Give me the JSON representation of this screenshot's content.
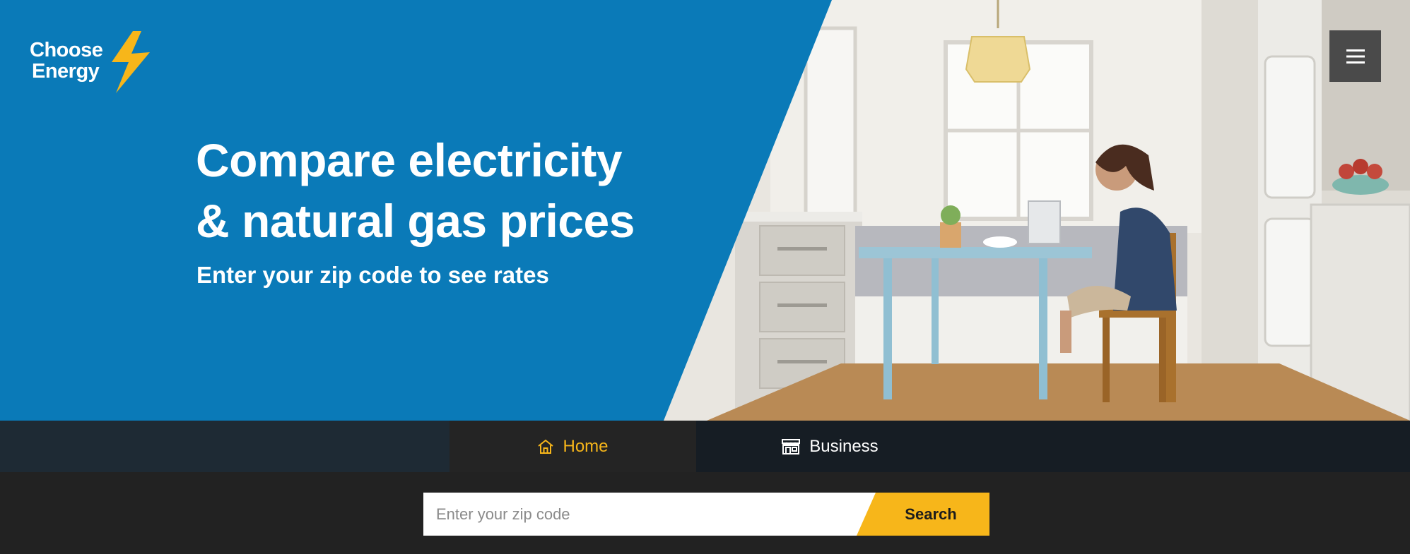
{
  "brand": {
    "line1": "Choose",
    "line2": "Energy"
  },
  "menu": {
    "icon": "hamburger-icon"
  },
  "hero": {
    "headline_line1": "Compare electricity",
    "headline_line2": "& natural gas prices",
    "subheadline": "Enter your zip code to see rates"
  },
  "tabs": [
    {
      "label": "Home",
      "icon": "house-icon",
      "active": true
    },
    {
      "label": "Business",
      "icon": "storefront-icon",
      "active": false
    }
  ],
  "search": {
    "placeholder": "Enter your zip code",
    "value": "",
    "button_label": "Search"
  },
  "colors": {
    "brand_blue": "#0a7ab8",
    "accent_yellow": "#f7b61a",
    "dark_bar": "#222222"
  }
}
